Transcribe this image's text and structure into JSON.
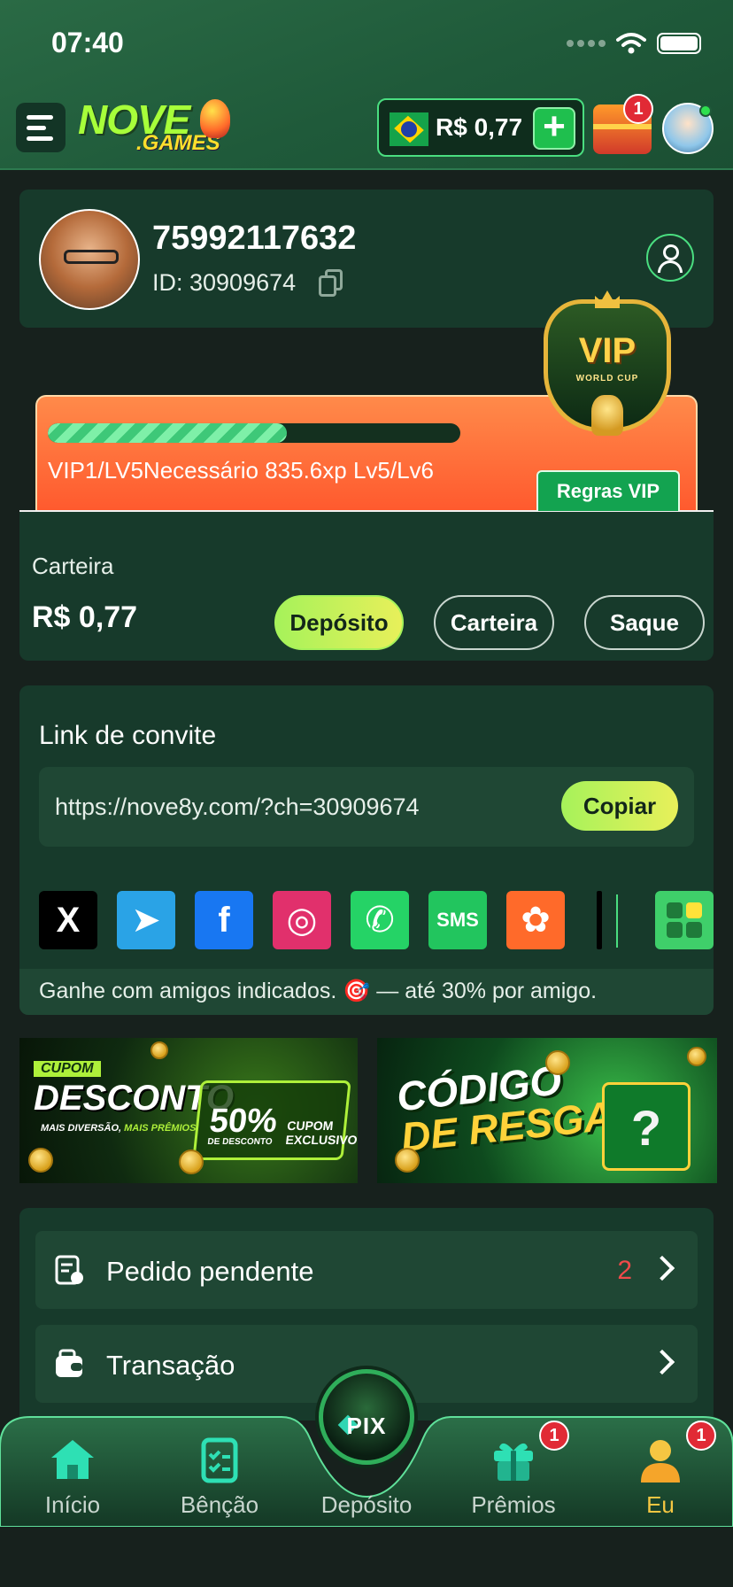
{
  "status_bar": {
    "time": "07:40"
  },
  "header": {
    "logo_main": "NOVE",
    "logo_sub": ".GAMES",
    "balance": "R$ 0,77",
    "add_symbol": "+",
    "rewards_badge": "1"
  },
  "profile": {
    "name": "75992117632",
    "id_text": "ID: 30909674"
  },
  "vip": {
    "progress_fraction": 0.58,
    "text": "VIP1/LV5Necessário 835.6xp Lv5/Lv6",
    "badge_title": "VIP",
    "badge_subtitle": "WORLD CUP",
    "rules_label": "Regras VIP"
  },
  "wallet": {
    "label": "Carteira",
    "amount": "R$ 0,77",
    "buttons": [
      "Depósito",
      "Carteira",
      "Saque"
    ]
  },
  "invite": {
    "title": "Link de convite",
    "url": "https://nove8y.com/?ch=30909674",
    "copy_label": "Copiar",
    "share_icons": [
      {
        "name": "x-icon",
        "glyph": "X",
        "bg": "#000000"
      },
      {
        "name": "telegram-icon",
        "glyph": "➤",
        "bg": "#2aa3e6"
      },
      {
        "name": "facebook-icon",
        "glyph": "f",
        "bg": "#1877f2"
      },
      {
        "name": "instagram-icon",
        "glyph": "◎",
        "bg": "#e1306c"
      },
      {
        "name": "whatsapp-icon",
        "glyph": "✆",
        "bg": "#25d366"
      },
      {
        "name": "sms-icon",
        "glyph": "SMS",
        "bg": "#22c55e"
      },
      {
        "name": "kwai-icon",
        "glyph": "✿",
        "bg": "#ff6a2a"
      }
    ],
    "footer": "Ganhe com amigos indicados. 🎯 — até 30% por amigo."
  },
  "banners": {
    "coupon": {
      "tag": "CUPOM",
      "title": "DESCONTO",
      "subtitle_a": "MAIS DIVERSÃO, ",
      "subtitle_b": "MAIS PRÊMIOS!",
      "percent": "50%",
      "percent_note": "DE DESCONTO",
      "cupom_label": "CUPOM EXCLUSIVO"
    },
    "redeem": {
      "line1": "CÓDIGO",
      "line2": "DE RESGATE",
      "gift_mark": "?"
    }
  },
  "menu": [
    {
      "label": "Pedido pendente",
      "count": "2"
    },
    {
      "label": "Transação",
      "count": ""
    }
  ],
  "bottom_nav": {
    "items": [
      "Início",
      "Bênção",
      "Depósito",
      "Prêmios",
      "Eu"
    ],
    "pix_label": "PIX",
    "premios_badge": "1",
    "eu_badge": "1"
  },
  "colors": {
    "accent_green": "#4ade80",
    "button_gradient_start": "#a6f25a",
    "button_gradient_end": "#e8f05a",
    "active_nav": "#f5c642",
    "badge_red": "#e12a35"
  }
}
